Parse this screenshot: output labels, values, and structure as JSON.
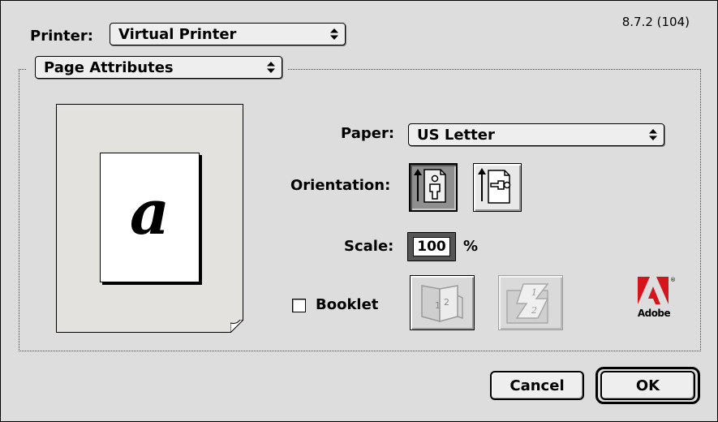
{
  "dialog": {
    "version": "8.7.2 (104)"
  },
  "printer": {
    "label": "Printer:",
    "selected": "Virtual Printer"
  },
  "panel": {
    "selected": "Page Attributes"
  },
  "preview": {
    "glyph": "a"
  },
  "paper": {
    "label": "Paper:",
    "selected": "US Letter"
  },
  "orientation": {
    "label": "Orientation:",
    "options": [
      "portrait",
      "landscape"
    ],
    "selected": "portrait"
  },
  "scale": {
    "label": "Scale:",
    "value": "100",
    "unit": "%"
  },
  "booklet": {
    "label": "Booklet",
    "checked": false,
    "page_numbers_a": [
      "1",
      "2"
    ],
    "page_numbers_b": [
      "1",
      "2"
    ]
  },
  "brand": {
    "name": "Adobe",
    "mark": "®",
    "color": "#d6141c"
  },
  "buttons": {
    "cancel": "Cancel",
    "ok": "OK"
  }
}
